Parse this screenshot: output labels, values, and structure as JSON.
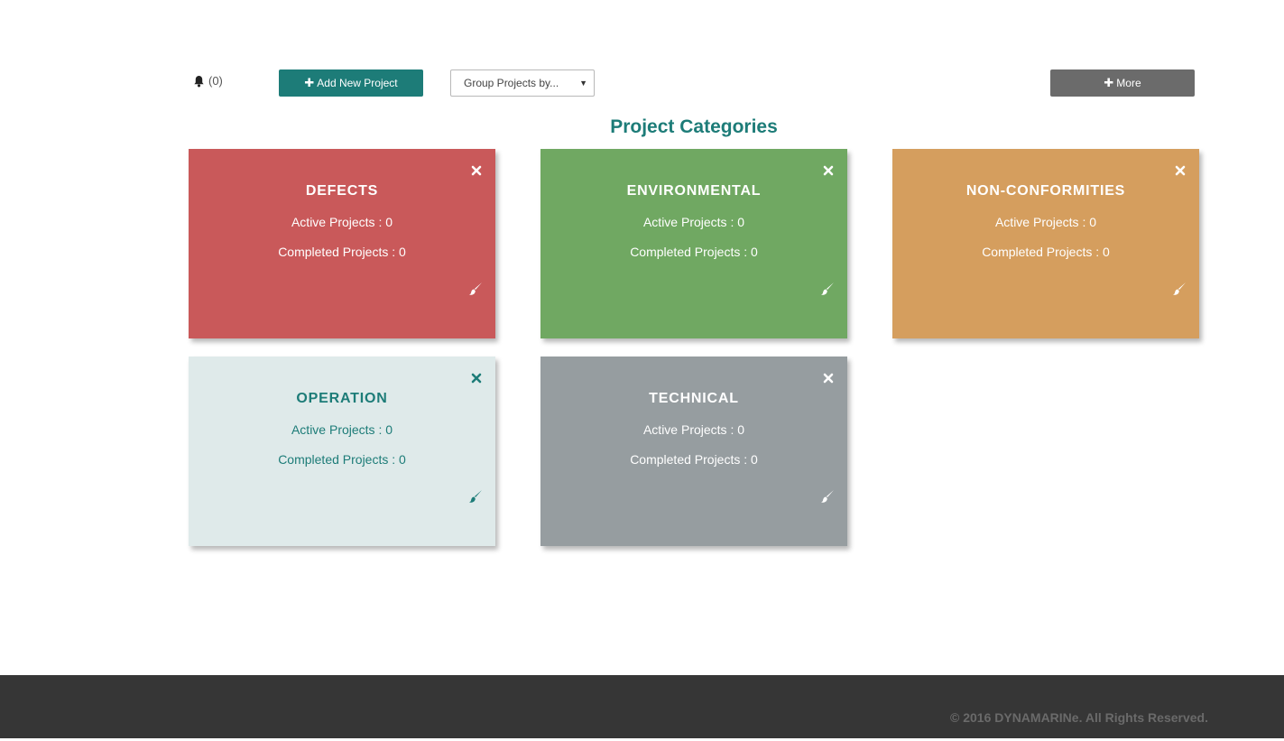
{
  "toolbar": {
    "notification_count": "(0)",
    "add_label": "Add New Project",
    "group_placeholder": "Group Projects by...",
    "more_label": "More"
  },
  "page": {
    "title": "Project Categories"
  },
  "categories": [
    {
      "name": "DEFECTS",
      "active": "Active Projects : 0",
      "completed": "Completed Projects : 0",
      "color": "#c9595a"
    },
    {
      "name": "ENVIRONMENTAL",
      "active": "Active Projects : 0",
      "completed": "Completed Projects : 0",
      "color": "#70a862"
    },
    {
      "name": "NON-CONFORMITIES",
      "active": "Active Projects : 0",
      "completed": "Completed Projects : 0",
      "color": "#d59e5e"
    },
    {
      "name": "OPERATION",
      "active": "Active Projects : 0",
      "completed": "Completed Projects : 0",
      "color": "#dfeaea"
    },
    {
      "name": "TECHNICAL",
      "active": "Active Projects : 0",
      "completed": "Completed Projects : 0",
      "color": "#969da0"
    }
  ],
  "icons": {
    "notification": "bell-icon",
    "add": "plus-icon",
    "close": "close-icon",
    "edit_color": "paint-brush-icon"
  },
  "colors": {
    "accent": "#1d7c78",
    "more_button": "#6b6b6b",
    "footer": "#363636"
  },
  "footer": {
    "copyright": "© 2016 DYNAMARINe. All Rights Reserved."
  }
}
